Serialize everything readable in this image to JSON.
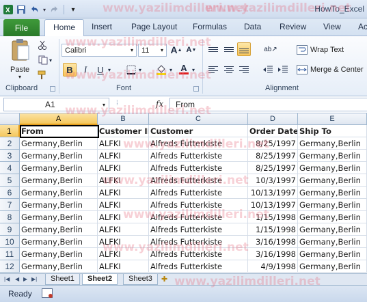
{
  "window": {
    "title": "HowTo_Excel"
  },
  "qat": {
    "icons": [
      "excel-icon",
      "save-icon",
      "undo-icon",
      "redo-icon",
      "customize-icon"
    ]
  },
  "tabs": [
    "File",
    "Home",
    "Insert",
    "Page Layout",
    "Formulas",
    "Data",
    "Review",
    "View",
    "Ac"
  ],
  "ribbon": {
    "clipboard": {
      "paste_label": "Paste",
      "group_label": "Clipboard"
    },
    "font": {
      "name": "Calibri",
      "size": "11",
      "group_label": "Font",
      "grow": "A",
      "shrink": "A",
      "bold": "B",
      "italic": "I",
      "underline": "U",
      "font_color": "A"
    },
    "alignment": {
      "wrap_text": "Wrap Text",
      "merge_center": "Merge & Center",
      "group_label": "Alignment"
    }
  },
  "formula_bar": {
    "name_box": "A1",
    "fx": "fx",
    "value": "From"
  },
  "grid": {
    "columns": [
      "A",
      "B",
      "C",
      "D",
      "E"
    ],
    "row_numbers": [
      "1",
      "2",
      "3",
      "4",
      "5",
      "6",
      "7",
      "8",
      "9",
      "10",
      "11",
      "12"
    ],
    "rows": [
      [
        "From",
        "Customer ID",
        "Customer",
        "Order Date",
        "Ship To"
      ],
      [
        "Germany,Berlin",
        "ALFKI",
        "Alfreds Futterkiste",
        "8/25/1997",
        "Germany,Berlin"
      ],
      [
        "Germany,Berlin",
        "ALFKI",
        "Alfreds Futterkiste",
        "8/25/1997",
        "Germany,Berlin"
      ],
      [
        "Germany,Berlin",
        "ALFKI",
        "Alfreds Futterkiste",
        "8/25/1997",
        "Germany,Berlin"
      ],
      [
        "Germany,Berlin",
        "ALFKI",
        "Alfreds Futterkiste",
        "10/3/1997",
        "Germany,Berlin"
      ],
      [
        "Germany,Berlin",
        "ALFKI",
        "Alfreds Futterkiste",
        "10/13/1997",
        "Germany,Berlin"
      ],
      [
        "Germany,Berlin",
        "ALFKI",
        "Alfreds Futterkiste",
        "10/13/1997",
        "Germany,Berlin"
      ],
      [
        "Germany,Berlin",
        "ALFKI",
        "Alfreds Futterkiste",
        "1/15/1998",
        "Germany,Berlin"
      ],
      [
        "Germany,Berlin",
        "ALFKI",
        "Alfreds Futterkiste",
        "1/15/1998",
        "Germany,Berlin"
      ],
      [
        "Germany,Berlin",
        "ALFKI",
        "Alfreds Futterkiste",
        "3/16/1998",
        "Germany,Berlin"
      ],
      [
        "Germany,Berlin",
        "ALFKI",
        "Alfreds Futterkiste",
        "3/16/1998",
        "Germany,Berlin"
      ],
      [
        "Germany,Berlin",
        "ALFKI",
        "Alfreds Futterkiste",
        "4/9/1998",
        "Germany,Berlin"
      ]
    ]
  },
  "sheets": [
    "Sheet1",
    "Sheet2",
    "Sheet3"
  ],
  "status": {
    "text": "Ready"
  },
  "watermark": "www.yazilimdilleri.net",
  "colors": {
    "file_tab": "#2a7a2a",
    "selection": "#f5c85d",
    "watermark": "#e76e7e"
  }
}
